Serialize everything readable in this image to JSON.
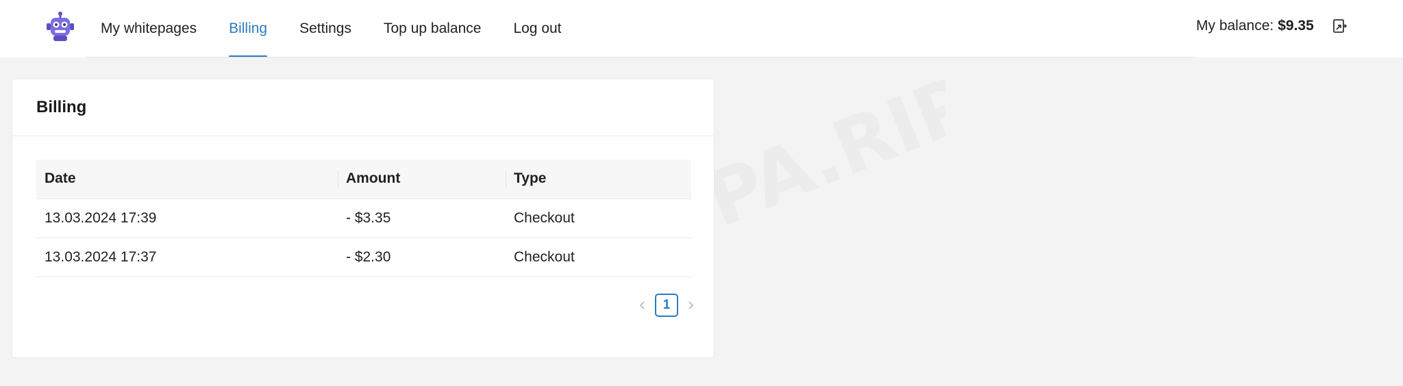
{
  "header": {
    "nav": [
      {
        "label": "My whitepages"
      },
      {
        "label": "Billing",
        "active": true
      },
      {
        "label": "Settings"
      },
      {
        "label": "Top up balance"
      },
      {
        "label": "Log out"
      }
    ],
    "balance_label": "My balance:",
    "balance_value": "$9.35",
    "logo_icon": "robot-icon",
    "logout_icon": "exit-icon"
  },
  "watermark": {
    "text": "CPA.RIP"
  },
  "billing": {
    "title": "Billing",
    "columns": [
      "Date",
      "Amount",
      "Type"
    ],
    "rows": [
      {
        "date": "13.03.2024 17:39",
        "amount": "- $3.35",
        "type": "Checkout"
      },
      {
        "date": "13.03.2024 17:37",
        "amount": "- $2.30",
        "type": "Checkout"
      }
    ],
    "pagination": {
      "current_page": "1",
      "prev_icon": "chevron-left-icon",
      "next_icon": "chevron-right-icon"
    }
  },
  "colors": {
    "accent": "#2a7bc0",
    "checkout": "#d9534f",
    "logo": "#6a5acd"
  }
}
